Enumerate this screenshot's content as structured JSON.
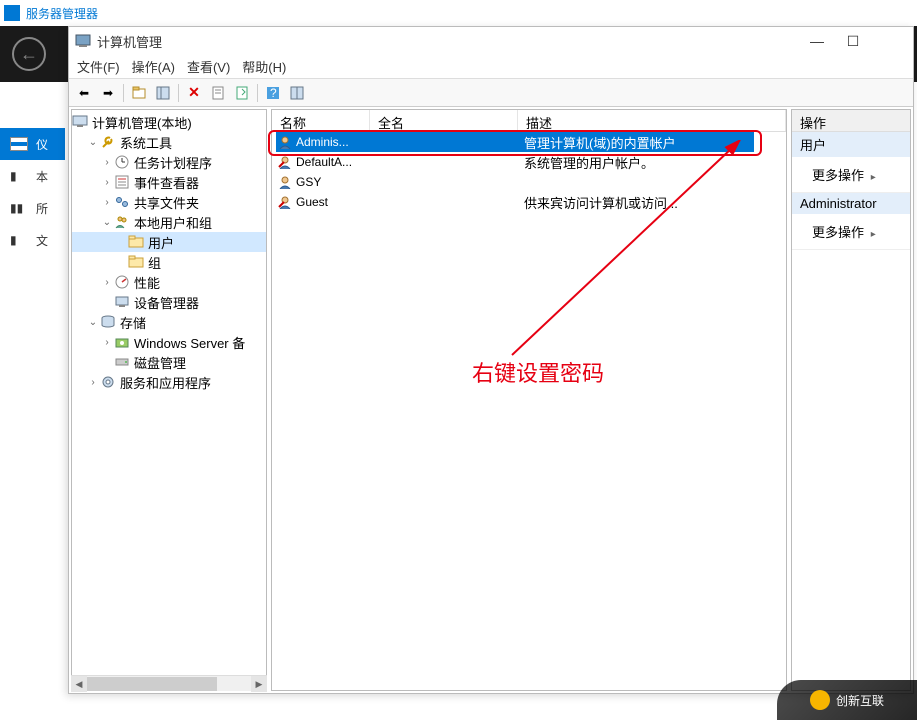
{
  "bg": {
    "title": "服务器管理器",
    "side": [
      {
        "label": "仪",
        "selected": true
      },
      {
        "label": "本"
      },
      {
        "label": "所"
      },
      {
        "label": "文"
      }
    ]
  },
  "cm": {
    "title": "计算机管理",
    "menus": [
      "文件(F)",
      "操作(A)",
      "查看(V)",
      "帮助(H)"
    ],
    "tree": {
      "root": "计算机管理(本地)",
      "sys_tools": "系统工具",
      "task_sched": "任务计划程序",
      "event_viewer": "事件查看器",
      "shared_folders": "共享文件夹",
      "local_users": "本地用户和组",
      "users": "用户",
      "groups": "组",
      "perf": "性能",
      "dev_mgr": "设备管理器",
      "storage": "存储",
      "wsb": "Windows Server 备",
      "disk_mgmt": "磁盘管理",
      "services_apps": "服务和应用程序"
    },
    "columns": {
      "name": "名称",
      "fullname": "全名",
      "desc": "描述"
    },
    "users": [
      {
        "name": "Adminis...",
        "full": "",
        "desc": "管理计算机(域)的内置帐户",
        "selected": true
      },
      {
        "name": "DefaultA...",
        "full": "",
        "desc": "系统管理的用户帐户。"
      },
      {
        "name": "GSY",
        "full": "",
        "desc": ""
      },
      {
        "name": "Guest",
        "full": "",
        "desc": "供来宾访问计算机或访问..."
      }
    ],
    "actions": {
      "title": "操作",
      "users_heading": "用户",
      "more1": "更多操作",
      "admin_heading": "Administrator",
      "more2": "更多操作"
    }
  },
  "annotation": "右键设置密码",
  "watermark": "创新互联"
}
